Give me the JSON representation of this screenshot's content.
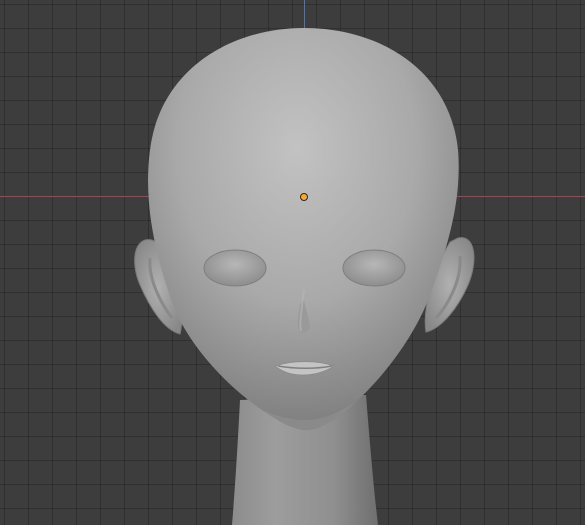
{
  "viewport": {
    "mode": "object-mode",
    "colors": {
      "background": "#3d3d3d",
      "x_axis": "#a8424f",
      "z_axis": "#4a76b8",
      "origin": "#ffa62b",
      "mesh": "#a6a6a6"
    }
  },
  "scene": {
    "object": "head-mesh",
    "features": [
      "cranium",
      "eye-sockets",
      "ears",
      "nose",
      "lips",
      "chin",
      "neck"
    ]
  }
}
